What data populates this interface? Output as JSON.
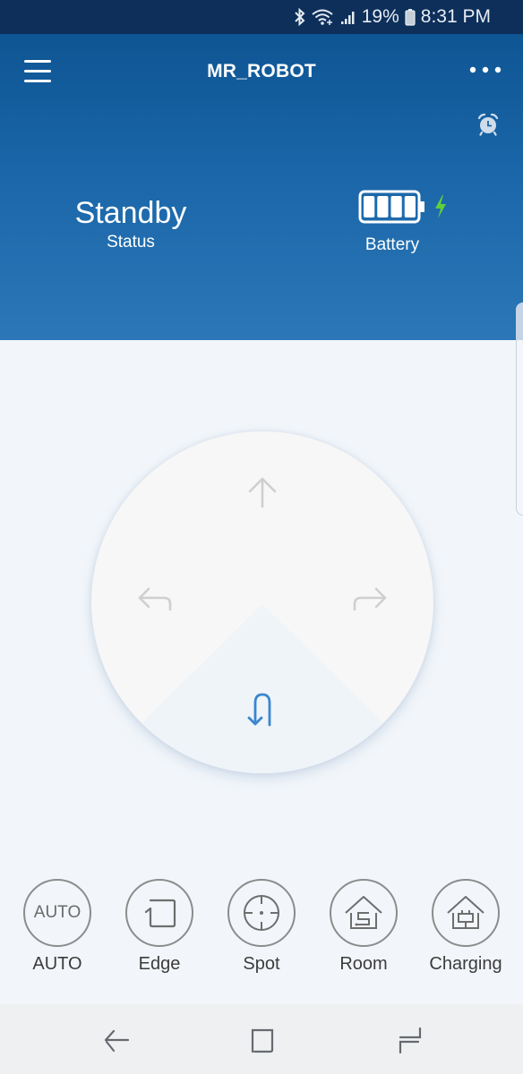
{
  "status_bar": {
    "icons": [
      "bluetooth-icon",
      "wifi-icon",
      "signal-icon"
    ],
    "battery_percent": "19%",
    "battery_icon": "phone-battery-icon",
    "time": "8:31 PM"
  },
  "header": {
    "menu_icon": "hamburger-menu-icon",
    "title": "MR_ROBOT",
    "more_icon": "more-dots-icon",
    "alarm_icon": "alarm-clock-icon",
    "status_value": "Standby",
    "status_label": "Status",
    "battery_label": "Battery",
    "battery_level_bars": 4,
    "battery_level_max": 4,
    "charging": true,
    "charging_color": "#5fd03a"
  },
  "joystick": {
    "buttons": [
      {
        "name": "forward",
        "icon": "arrow-up-icon"
      },
      {
        "name": "turn-left",
        "icon": "turn-left-arrow-icon"
      },
      {
        "name": "turn-right",
        "icon": "turn-right-arrow-icon"
      },
      {
        "name": "u-turn",
        "icon": "u-turn-icon",
        "active": true
      }
    ],
    "active_color": "#3a86d0",
    "inactive_color": "#cfcfcf"
  },
  "modes": [
    {
      "label": "AUTO",
      "icon_text": "AUTO",
      "icon": "auto-mode-icon"
    },
    {
      "label": "Edge",
      "icon": "edge-clean-icon"
    },
    {
      "label": "Spot",
      "icon": "spot-target-icon"
    },
    {
      "label": "Room",
      "icon": "room-house-icon"
    },
    {
      "label": "Charging",
      "icon": "charging-house-icon"
    }
  ],
  "nav_bar": {
    "back_icon": "back-icon",
    "home_icon": "home-icon",
    "recents_icon": "recents-icon"
  },
  "colors": {
    "header_top": "#0e5593",
    "header_bottom": "#2b77b7",
    "status_bar": "#0d2f5a",
    "background": "#f2f6fa"
  }
}
